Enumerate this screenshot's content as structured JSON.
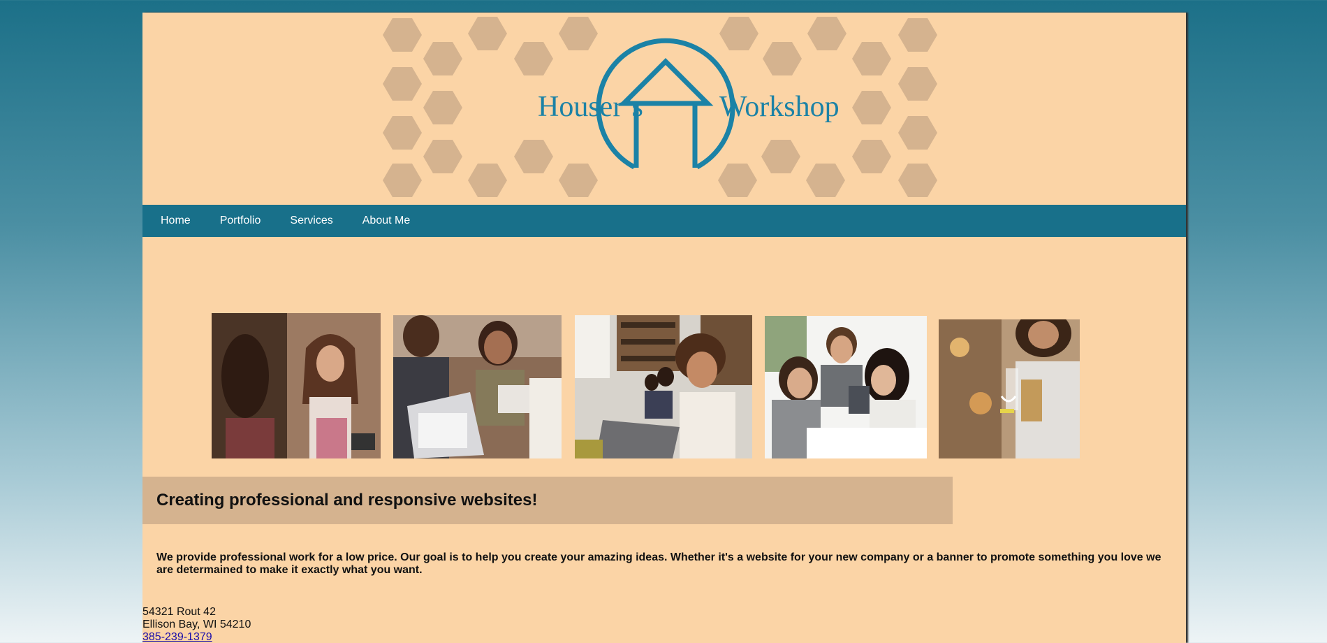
{
  "brand": {
    "name_left": "Houser’s",
    "name_right": "Workshop",
    "colors": {
      "primary": "#18708a",
      "logo": "#1b82a6",
      "page_bg": "#fbd4a6",
      "hexagons": "#d5b38f"
    }
  },
  "nav": {
    "items": [
      {
        "label": "Home"
      },
      {
        "label": "Portfolio"
      },
      {
        "label": "Services"
      },
      {
        "label": "About Me"
      }
    ]
  },
  "gallery": [
    {
      "name": "photo-shop-owner-with-tablet"
    },
    {
      "name": "photo-handshake-meeting"
    },
    {
      "name": "photo-people-working-laptops"
    },
    {
      "name": "photo-team-looking-at-laptop"
    },
    {
      "name": "photo-woman-using-phone"
    }
  ],
  "tagline": "Creating professional and responsive websites!",
  "description": "We provide professional work for a low price. Our goal is to help you create your amazing ideas. Whether it's a website for your new company or a banner to promote something you love we are determained to make it exactly what you want.",
  "contact": {
    "street": "54321 Rout 42",
    "city": "Ellison Bay, WI 54210",
    "phone": "385-239-1379"
  }
}
